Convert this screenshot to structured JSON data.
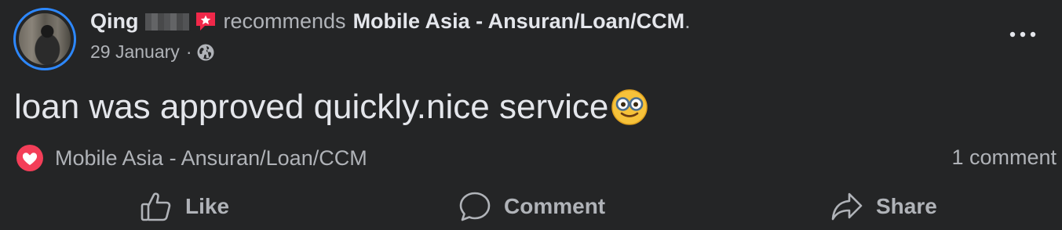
{
  "post": {
    "author": "Qing",
    "verb": "recommends",
    "page": "Mobile Asia - Ansuran/Loan/CCM",
    "page_end": ".",
    "date": "29 January",
    "date_sep": "·",
    "privacy_icon": "globe-icon",
    "body": "loan was approved quickly.nice service",
    "body_emoji": "nerd-glasses-emoji"
  },
  "reactions": {
    "icon": "love-reaction-icon",
    "reactor": "Mobile Asia - Ansuran/Loan/CCM",
    "comments": "1 comment"
  },
  "actions": {
    "like": "Like",
    "comment": "Comment",
    "share": "Share"
  },
  "colors": {
    "background": "#242526",
    "primary_text": "#e4e6eb",
    "secondary_text": "#b0b3b8",
    "story_ring": "#2d88ff",
    "recommend_badge": "#f02849",
    "love_reaction": "#f33e58"
  }
}
